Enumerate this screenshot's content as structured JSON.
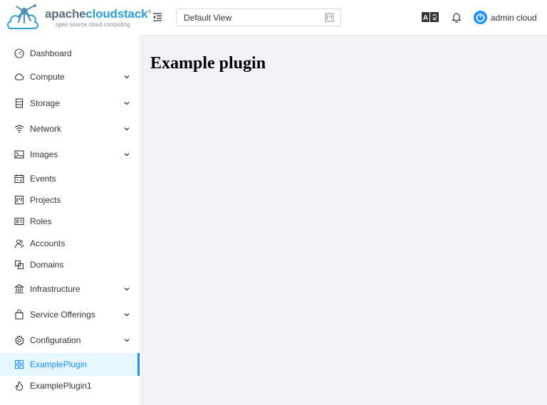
{
  "brand": {
    "name_part1": "apache",
    "name_part2": "cloudstack",
    "trademark": "®",
    "tagline": "open source cloud computing"
  },
  "header": {
    "project_select_value": "Default View",
    "user_name": "admin cloud"
  },
  "sidebar": {
    "items": [
      {
        "label": "Dashboard",
        "icon": "dashboard-icon",
        "has_submenu": false
      },
      {
        "label": "Compute",
        "icon": "cloud-icon",
        "has_submenu": true
      },
      {
        "label": "Storage",
        "icon": "database-icon",
        "has_submenu": true
      },
      {
        "label": "Network",
        "icon": "wifi-icon",
        "has_submenu": true
      },
      {
        "label": "Images",
        "icon": "picture-icon",
        "has_submenu": true
      },
      {
        "label": "Events",
        "icon": "schedule-icon",
        "has_submenu": false
      },
      {
        "label": "Projects",
        "icon": "project-icon",
        "has_submenu": false
      },
      {
        "label": "Roles",
        "icon": "idcard-icon",
        "has_submenu": false
      },
      {
        "label": "Accounts",
        "icon": "team-icon",
        "has_submenu": false
      },
      {
        "label": "Domains",
        "icon": "block-icon",
        "has_submenu": false
      },
      {
        "label": "Infrastructure",
        "icon": "bank-icon",
        "has_submenu": true
      },
      {
        "label": "Service Offerings",
        "icon": "shopping-icon",
        "has_submenu": true
      },
      {
        "label": "Configuration",
        "icon": "setting-icon",
        "has_submenu": true
      },
      {
        "label": "ExamplePlugin",
        "icon": "appstore-icon",
        "has_submenu": false,
        "active": true
      },
      {
        "label": "ExamplePlugin1",
        "icon": "fire-icon",
        "has_submenu": false
      }
    ]
  },
  "main": {
    "title": "Example plugin"
  },
  "colors": {
    "accent": "#1890ff",
    "brand_blue": "#28a0d7",
    "brand_gray": "#5b6f7f",
    "content_bg": "#f0f2f5"
  }
}
